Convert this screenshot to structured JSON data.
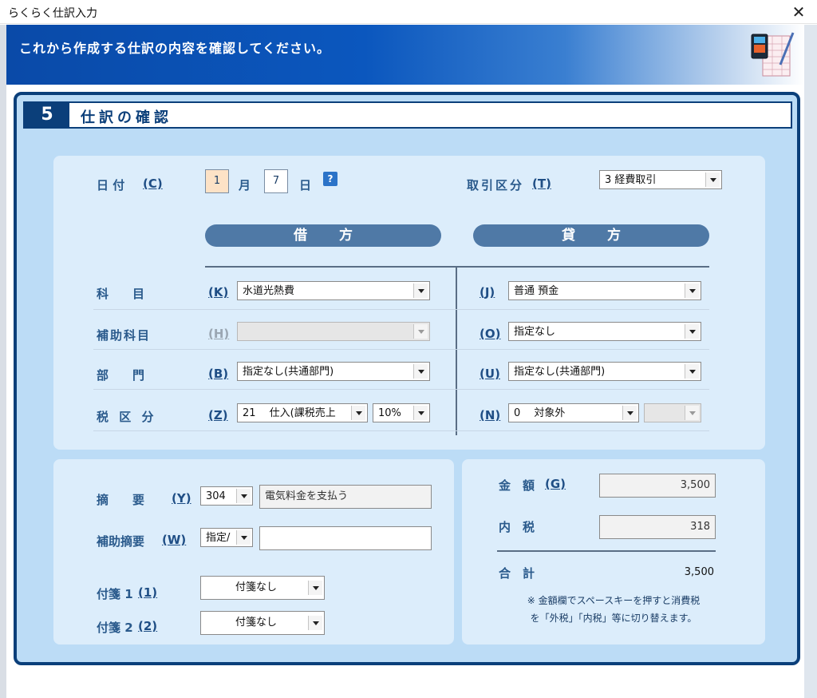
{
  "window": {
    "title": "らくらく仕訳入力",
    "close_symbol": "✕"
  },
  "banner": {
    "message": "これから作成する仕訳の内容を確認してください。",
    "icon": "document-pen-icon"
  },
  "step": {
    "number": "5",
    "title": "仕訳の確認"
  },
  "date": {
    "label": "日 付",
    "key": "(C)",
    "month": "1",
    "month_unit": "月",
    "day": "7",
    "day_unit": "日",
    "help": "?"
  },
  "transaction_type": {
    "label": "取引区分",
    "key": "(T)",
    "value": "3  経費取引"
  },
  "columns": {
    "debit": "借方",
    "credit": "貸方"
  },
  "rows": {
    "account": {
      "label": "科　　目",
      "debit_key": "(K)",
      "debit_value": "水道光熱費",
      "credit_key": "(J)",
      "credit_value": "普通  預金"
    },
    "sub_account": {
      "label": "補助科目",
      "debit_key": "(H)",
      "debit_value": "",
      "credit_key": "(O)",
      "credit_value": "指定なし"
    },
    "department": {
      "label": "部　　門",
      "debit_key": "(B)",
      "debit_value": "指定なし(共通部門)",
      "credit_key": "(U)",
      "credit_value": "指定なし(共通部門)"
    },
    "tax": {
      "label": "税 区 分",
      "debit_key": "(Z)",
      "debit_value": "21　 仕入(課税売上",
      "debit_rate": "10%",
      "credit_key": "(N)",
      "credit_value": "0　  対象外",
      "credit_rate": ""
    }
  },
  "memo": {
    "label": "摘　　要",
    "key": "(Y)",
    "code": "304",
    "text": "電気料金を支払う",
    "sub_label": "補助摘要",
    "sub_key": "(W)",
    "sub_code": "指定/",
    "sub_text": ""
  },
  "tags": {
    "tag1_label": "付箋 1",
    "tag1_key": "(1)",
    "tag1_value": "付箋なし",
    "tag2_label": "付箋 2",
    "tag2_key": "(2)",
    "tag2_value": "付箋なし"
  },
  "amount": {
    "label": "金　額",
    "key": "(G)",
    "value": "3,500",
    "tax_label": "内　税",
    "tax_value": "318",
    "total_label": "合　計",
    "total_value": "3,500",
    "note_line1": "※ 金額欄でスペースキーを押すと消費税",
    "note_line2": "を「外税」「内税」等に切り替えます。"
  },
  "colors": {
    "panel_border": "#0b3f7a",
    "panel_bg": "#bcdcf6",
    "inner_bg": "#dcedfb",
    "pill": "#4f79a6",
    "banner": "#0b57be"
  }
}
